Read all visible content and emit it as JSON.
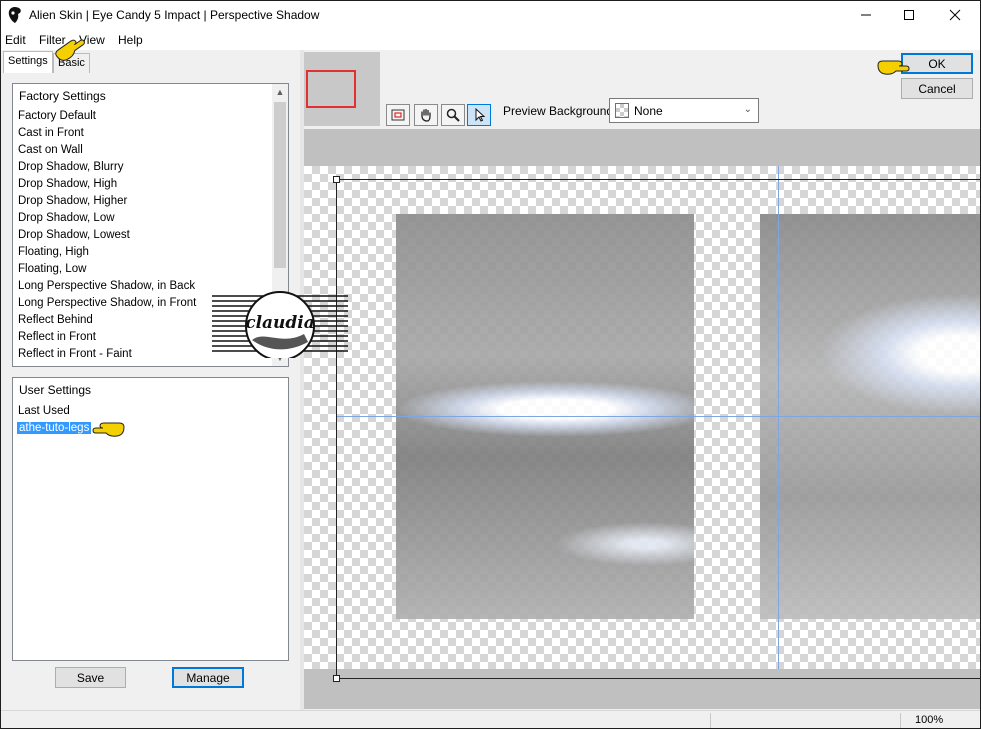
{
  "window": {
    "title": "Alien Skin | Eye Candy 5 Impact | Perspective Shadow",
    "minimize_icon": "minimize-icon",
    "maximize_icon": "maximize-icon",
    "close_icon": "close-icon"
  },
  "menu": [
    "Edit",
    "Filter",
    "View",
    "Help"
  ],
  "tabs": [
    {
      "label": "Settings",
      "active": true
    },
    {
      "label": "Basic",
      "active": false
    }
  ],
  "factory_settings": {
    "header": "Factory Settings",
    "items": [
      "Factory Default",
      "Cast in Front",
      "Cast on Wall",
      "Drop Shadow, Blurry",
      "Drop Shadow, High",
      "Drop Shadow, Higher",
      "Drop Shadow, Low",
      "Drop Shadow, Lowest",
      "Floating, High",
      "Floating, Low",
      "Long Perspective Shadow, in Back",
      "Long Perspective Shadow, in Front",
      "Reflect Behind",
      "Reflect in Front",
      "Reflect in Front - Faint"
    ]
  },
  "user_settings": {
    "header": "User Settings",
    "items": [
      "Last Used",
      "athe-tuto-legs"
    ],
    "selected": "athe-tuto-legs"
  },
  "buttons": {
    "save": "Save",
    "manage": "Manage",
    "ok": "OK",
    "cancel": "Cancel"
  },
  "toolbar": {
    "tools": [
      "navigator-icon",
      "hand-pan-icon",
      "zoom-magnifier-icon",
      "arrow-select-icon"
    ],
    "active_tool": "arrow-select-icon"
  },
  "preview_background": {
    "label": "Preview Background:",
    "value": "None"
  },
  "watermark": {
    "text": "claudia"
  },
  "status": {
    "zoom": "100%"
  },
  "colors": {
    "selection": "#3399ff",
    "guide": "#7fa6e0",
    "nav_rect": "#e03030",
    "pointer": "#f5d000"
  }
}
